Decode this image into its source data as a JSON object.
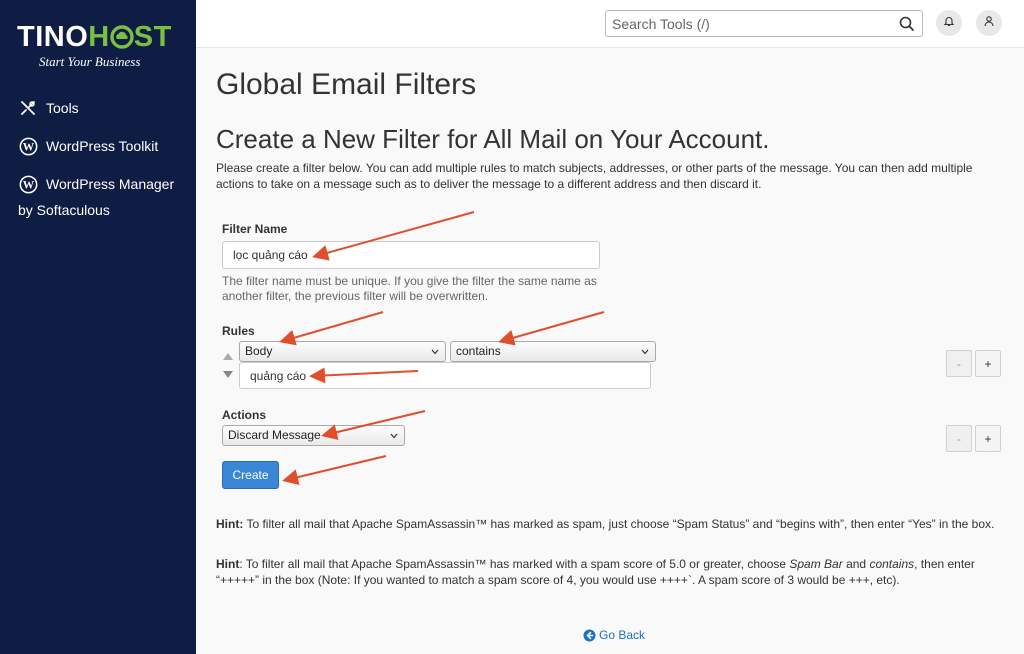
{
  "brand": {
    "logo_part1": "TINO",
    "logo_part2_a": "H",
    "logo_part2_b": "ST",
    "tagline": "Start Your Business",
    "color_primary": "#0f1d45",
    "color_accent": "#7ac143"
  },
  "sidebar": {
    "items": [
      {
        "label": "Tools",
        "icon": "tools-icon"
      },
      {
        "label": "WordPress Toolkit",
        "icon": "wordpress-icon"
      },
      {
        "label": "WordPress Manager",
        "label_line2": "by Softaculous",
        "icon": "wordpress-icon"
      }
    ]
  },
  "topbar": {
    "search_placeholder": "Search Tools (/)",
    "icons": [
      "search-icon",
      "bell-icon",
      "user-icon"
    ]
  },
  "page": {
    "title": "Global Email Filters",
    "subtitle": "Create a New Filter for All Mail on Your Account.",
    "intro": "Please create a filter below. You can add multiple rules to match subjects, addresses, or other parts of the message. You can then add multiple actions to take on a message such as to deliver the message to a different address and then discard it."
  },
  "form": {
    "filter_name_label": "Filter Name",
    "filter_name_value": "lọc quảng cáo",
    "filter_name_help": "The filter name must be unique. If you give the filter the same name as another filter, the previous filter will be overwritten.",
    "rules_label": "Rules",
    "rule_field": "Body",
    "rule_operator": "contains",
    "rule_value": "quảng cáo",
    "actions_label": "Actions",
    "action_value": "Discard Message",
    "minus_label": "-",
    "plus_label": "+",
    "create_label": "Create"
  },
  "hints": {
    "hint1_label": "Hint:",
    "hint1_text": " To filter all mail that Apache SpamAssassin™ has marked as spam, just choose “Spam Status” and “begins with”, then enter “Yes” in the box.",
    "hint2_label": "Hint",
    "hint2_text_a": ": To filter all mail that Apache SpamAssassin™ has marked with a spam score of 5.0 or greater, choose ",
    "hint2_em1": "Spam Bar",
    "hint2_text_b": " and ",
    "hint2_em2": "contains",
    "hint2_text_c": ", then enter “+++++” in the box (Note: If you wanted to match a spam score of 4, you would use ++++`. A spam score of 3 would be +++, etc)."
  },
  "footer": {
    "go_back": "Go Back"
  },
  "annotation_color": "#e04e2b"
}
